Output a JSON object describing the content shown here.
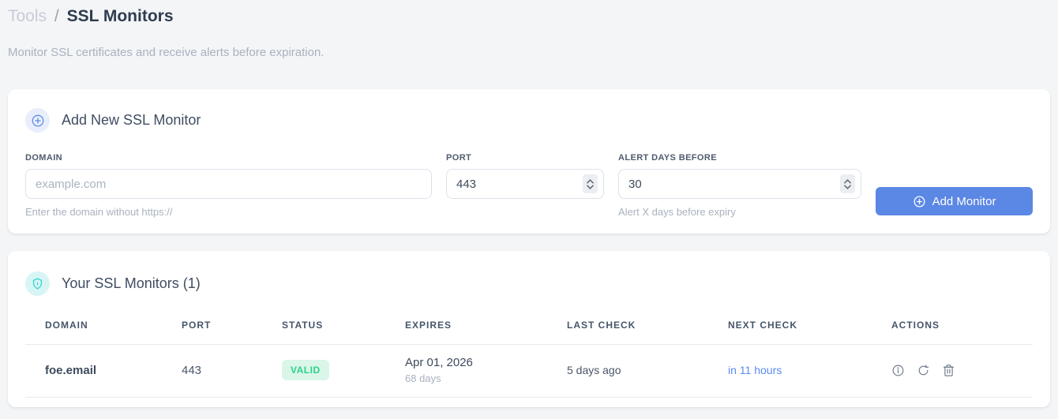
{
  "page": {
    "breadcrumb": {
      "parent": "Tools",
      "separator": "/",
      "current": "SSL Monitors"
    },
    "subtitle": "Monitor SSL certificates and receive alerts before expiration."
  },
  "add_monitor_card": {
    "title": "Add New SSL Monitor",
    "icon": "plus-circle-icon",
    "fields": {
      "domain": {
        "label": "DOMAIN",
        "placeholder": "example.com",
        "hint": "Enter the domain without https://"
      },
      "port": {
        "label": "PORT",
        "value": "443"
      },
      "alert_days": {
        "label": "ALERT DAYS BEFORE",
        "value": "30",
        "hint": "Alert X days before expiry"
      }
    },
    "submit_label": "Add Monitor"
  },
  "monitors_card": {
    "title": "Your SSL Monitors (1)",
    "icon": "shield-icon",
    "table": {
      "headers": [
        "DOMAIN",
        "PORT",
        "STATUS",
        "EXPIRES",
        "LAST CHECK",
        "NEXT CHECK",
        "ACTIONS"
      ],
      "rows": [
        {
          "domain": "foe.email",
          "port": "443",
          "status": "VALID",
          "expires_date": "Apr 01, 2026",
          "expires_days": "68 days",
          "last_check": "5 days ago",
          "next_check": "in 11 hours",
          "actions": [
            "info-icon",
            "refresh-icon",
            "trash-icon"
          ]
        }
      ]
    }
  },
  "colors": {
    "accent_blue": "#5b87e5",
    "link_blue": "#5b8cf0",
    "valid_badge_bg": "#d9f6e8",
    "valid_badge_text": "#31d08c",
    "shield_teal": "#35d6ce",
    "page_bg": "#f4f5f7"
  }
}
